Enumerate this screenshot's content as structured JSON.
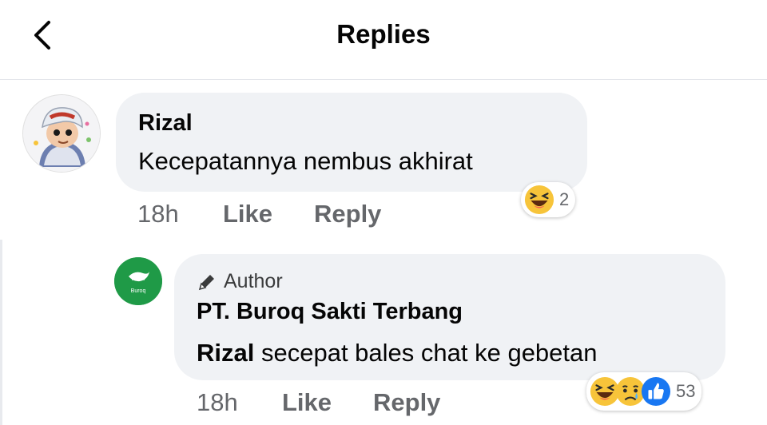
{
  "header": {
    "title": "Replies",
    "back_label": "Back"
  },
  "comment": {
    "author": "Rizal",
    "text": "Kecepatannya nembus akhirat",
    "time": "18h",
    "like_label": "Like",
    "reply_label": "Reply",
    "reaction_count": "2",
    "reactions": [
      "haha"
    ]
  },
  "reply": {
    "badge": "Author",
    "author": "PT. Buroq Sakti Terbang",
    "mention": "Rizal",
    "text": "secepat bales chat ke gebetan",
    "time": "18h",
    "like_label": "Like",
    "reply_label": "Reply",
    "reaction_count": "53",
    "reactions": [
      "haha",
      "sad",
      "like"
    ],
    "avatar_logo_text": "Buroq"
  },
  "colors": {
    "bubble": "#f0f2f5",
    "meta_text": "#65676b",
    "like_blue": "#1877f2",
    "emoji_yellow": "#f7c43a",
    "brand_green": "#1f9a47"
  }
}
